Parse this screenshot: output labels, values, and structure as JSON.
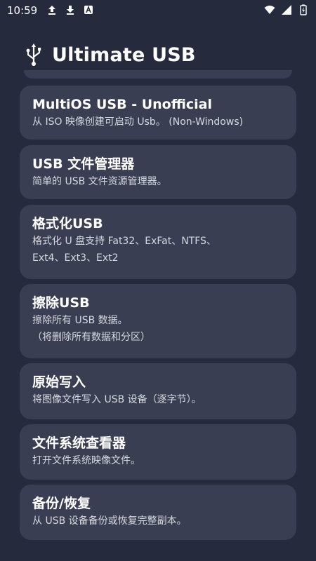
{
  "status_bar": {
    "time": "10:59",
    "icons_left": [
      "upload-icon",
      "download-icon",
      "app-notification-icon"
    ],
    "icons_right": [
      "wifi-icon",
      "signal-icon",
      "battery-icon"
    ]
  },
  "header": {
    "logo_icon": "usb-icon",
    "title": "Ultimate USB"
  },
  "options": [
    {
      "title": "MultiOS USB - Unofficial",
      "desc_lines": [
        "从 ISO 映像创建可启动 Usb。 (Non-Windows)"
      ]
    },
    {
      "title": "USB 文件管理器",
      "desc_lines": [
        "简单的 USB 文件资源管理器。"
      ]
    },
    {
      "title": "格式化USB",
      "desc_lines": [
        "格式化 U 盘支持 Fat32、ExFat、NTFS、",
        "Ext4、Ext3、Ext2"
      ]
    },
    {
      "title": "擦除USB",
      "desc_lines": [
        "擦除所有 USB 数据。",
        "（将删除所有数据和分区）"
      ]
    },
    {
      "title": "原始写入",
      "desc_lines": [
        "将图像文件写入 USB 设备（逐字节）。"
      ]
    },
    {
      "title": "文件系统查看器",
      "desc_lines": [
        "打开文件系统映像文件。"
      ]
    },
    {
      "title": "备份/恢复",
      "desc_lines": [
        "从 USB 设备备份或恢复完整副本。"
      ]
    }
  ],
  "colors": {
    "background": "#262a3d",
    "card": "#3a3e52",
    "title_text": "#ffffff",
    "desc_text": "#d7d9e1"
  }
}
